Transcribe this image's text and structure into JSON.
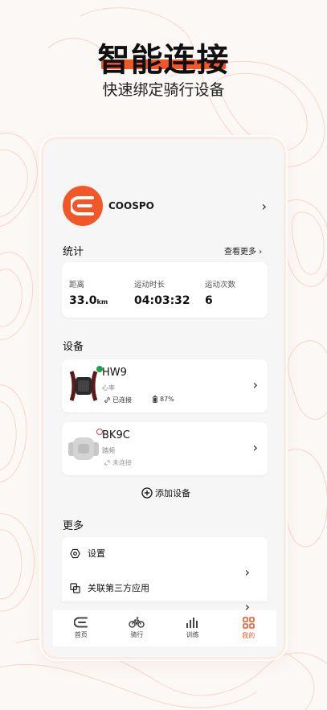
{
  "hero": {
    "title": "智能连接",
    "subtitle": "快速绑定骑行设备"
  },
  "colors": {
    "accent": "#f2572a",
    "connected": "#1fa34a",
    "disconnected": "#d9363e"
  },
  "profile": {
    "name": "COOSPO",
    "logo_icon": "coospo-logo-icon"
  },
  "stats": {
    "section_label": "统计",
    "more_label": "查看更多",
    "items": [
      {
        "label": "距离",
        "value": "33.0",
        "unit": "km"
      },
      {
        "label": "运动时长",
        "value": "04:03:32",
        "unit": ""
      },
      {
        "label": "运动次数",
        "value": "6",
        "unit": ""
      }
    ]
  },
  "devices": {
    "section_label": "设备",
    "items": [
      {
        "name": "HW9",
        "type": "心率",
        "status": "已连接",
        "battery": "87%",
        "connected": true
      },
      {
        "name": "BK9C",
        "type": "踏频",
        "status": "未连接",
        "connected": false
      }
    ],
    "add_label": "添加设备"
  },
  "more": {
    "section_label": "更多",
    "items": [
      {
        "label": "设置",
        "icon": "settings-hex-icon"
      },
      {
        "label": "关联第三方应用",
        "icon": "link-apps-icon"
      }
    ]
  },
  "tabs": [
    {
      "label": "首页",
      "icon": "home-icon",
      "active": false
    },
    {
      "label": "骑行",
      "icon": "bike-icon",
      "active": false
    },
    {
      "label": "训练",
      "icon": "training-bars-icon",
      "active": false
    },
    {
      "label": "我的",
      "icon": "my-grid-icon",
      "active": true
    }
  ]
}
